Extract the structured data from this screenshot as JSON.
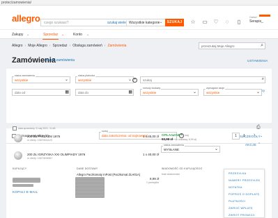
{
  "browser": {
    "url": "protec/zamowienia/"
  },
  "header": {
    "logo": "allegro",
    "search_placeholder": "czego szukasz?",
    "search_inside": "szukaj wiele",
    "category": "Wszystkie kategorie",
    "search_button": "SZUKAJ",
    "user_greeting": "Cześć!",
    "user_name": "Serapis_",
    "icons": [
      "star-icon",
      "chat-icon",
      "heart-icon",
      "bell-icon",
      "cart-icon"
    ]
  },
  "nav": {
    "items": [
      "Zakupy",
      "Sprzedaż",
      "Konto"
    ],
    "active": "Sprzedaż"
  },
  "breadcrumb": [
    "Allegro",
    "Moje Allegro",
    "Sprzedaż",
    "Obsługa zamówień",
    "Zamówienia"
  ],
  "order_search_placeholder": "przeszukaj Moje Allegro",
  "page": {
    "title": "Zamówienia",
    "title_link": "Poznaj zamówienia",
    "settings_link": "USTAWIENIA"
  },
  "filters": {
    "clear": "wyczyść filtry",
    "status_label": "status zamówienia",
    "status_value": "wszystkie",
    "payment_label": "status płatności",
    "payment_value": "wszystkie",
    "search_placeholder": "szukaj",
    "date_from": "data od",
    "date_to": "data do",
    "delivery_label": "metody dostawy",
    "delivery_value": "wszystkie",
    "action_label": "wymagane akcje",
    "action_value": "wszystkie"
  },
  "list": {
    "select_all": "zaznacz wszystkie (1)",
    "sort_label": "sortuj",
    "sort_value": "data zakończenia: od najnowszej",
    "page": "1",
    "page_total": "1"
  },
  "order": {
    "date": "data sprzedaży: 5 maj 2021, 11:48",
    "details_btn": "SZCZEGÓŁY",
    "actions_btn": "AKCJE",
    "items": [
      {
        "title": "200 ZŁ FASZYZM 1975",
        "offer": "nr oferty: 10670311123",
        "price": "1 x 45,00 zł"
      },
      {
        "title": "200 ZŁ IGRZYSKA XXI OLIMPIADY 1976",
        "offer": "nr oferty: 10670494567",
        "price": "1 x 40,00 zł"
      }
    ],
    "payment_status": "OPŁACONE",
    "paid_date": "5 maj",
    "paid_amount": "93,99 zł",
    "paid_note": "(z dostawą: 8,99 zł)",
    "order_status_label": "status zamówienia",
    "order_status_value": "WYSŁANE",
    "buyer_label": "KUPUJĄCY",
    "buyer_copy": "KOPIUJ E-MAIL",
    "delivery_label": "DANE DOSTAWY",
    "delivery_method": "Allegro Paczkomaty InPost (Paczkomat ZLH01A)",
    "delivery_price": "8,99 zł",
    "delivery_count": "1 przesyłka",
    "message_label": "WIADOMOŚĆ OD KUPUJĄCEGO",
    "message_value": "brak wiadomości"
  },
  "actions_menu": [
    "PRZESYŁKA",
    "NUMERY PRZESYŁEK",
    "NOTATKA",
    "POPROŚ O DOPŁATĘ",
    "PŁATNOŚCI",
    "ZWROĆ WPŁATĘ",
    "ZWROT PROWIZJI"
  ],
  "colors": {
    "brand": "#ff5a00",
    "link": "#1a73b8",
    "paid": "#2ba84a",
    "bg": "#eef0f3"
  }
}
